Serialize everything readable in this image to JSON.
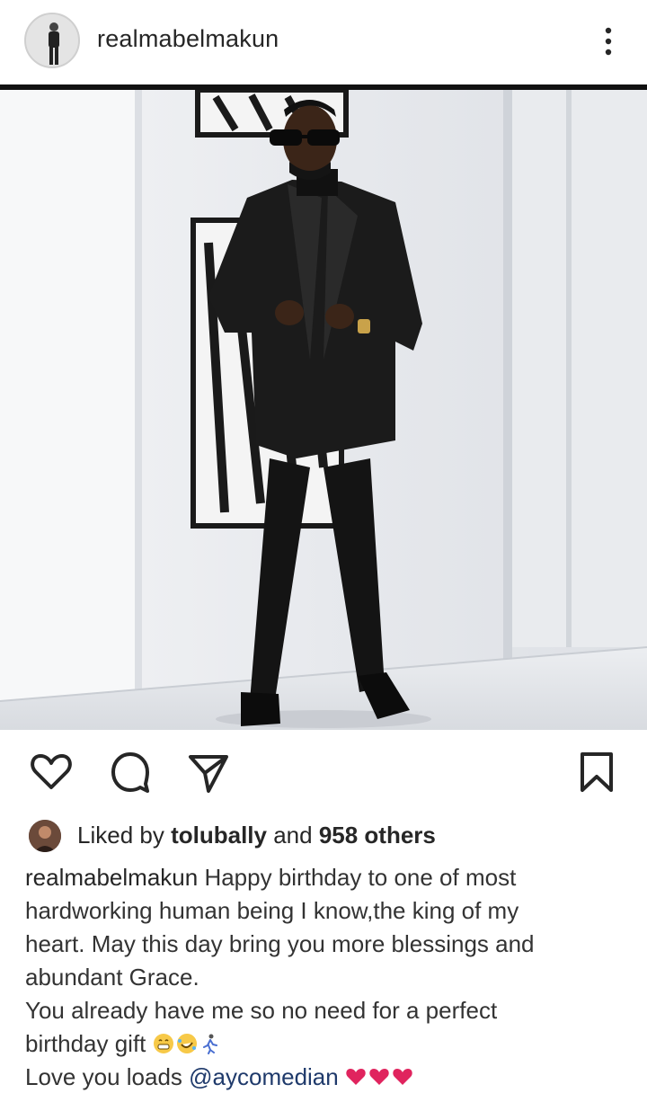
{
  "header": {
    "username": "realmabelmakun",
    "menu_icon": "more-vertical-icon"
  },
  "photo": {
    "subject": "man in black suit with sunglasses standing by white wall"
  },
  "actions": {
    "like_icon": "heart-icon",
    "comment_icon": "comment-icon",
    "share_icon": "send-icon",
    "save_icon": "bookmark-icon"
  },
  "likes": {
    "prefix": "Liked by ",
    "user": "tolubally",
    "middle": " and ",
    "others": "958 others"
  },
  "caption": {
    "username": "realmabelmakun",
    "line1": " Happy birthday to one of most",
    "line2": "hardworking human being I know,the king of my",
    "line3": "heart. May this day bring you more blessings and",
    "line4": "abundant Grace.",
    "line5": "You already have me so no need for a perfect",
    "line6": "birthday gift",
    "line7_prefix": "Love you loads ",
    "mention": "@aycomedian"
  },
  "colors": {
    "text": "#262626",
    "heart": "#e0245e",
    "header_rule": "#111111"
  }
}
